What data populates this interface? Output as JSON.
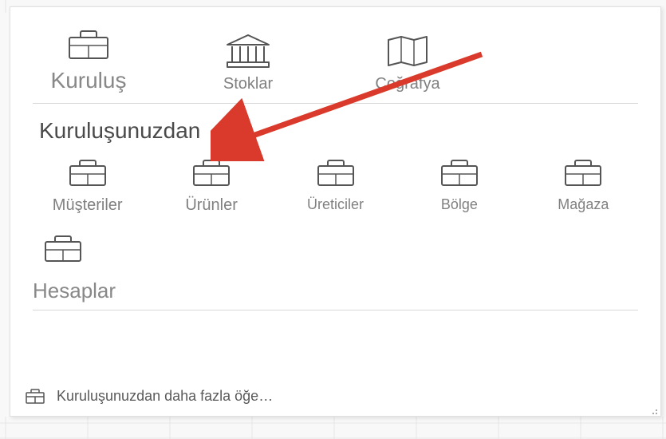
{
  "top_tabs": {
    "org": {
      "label": "Kuruluş"
    },
    "stocks": {
      "label": "Stoklar"
    },
    "geo": {
      "label": "Coğrafya"
    }
  },
  "from_org_title": "Kuruluşunuzdan",
  "items": {
    "customers": {
      "label": "Müşteriler"
    },
    "products": {
      "label": "Ürünler"
    },
    "manufacturers": {
      "label": "Üreticiler"
    },
    "region": {
      "label": "Bölge"
    },
    "store": {
      "label": "Mağaza"
    }
  },
  "accounts_title": "Hesaplar",
  "footer_more_from_org": "Kuruluşunuzdan daha fazla öğe…",
  "colors": {
    "arrow": "#D93A2B"
  }
}
